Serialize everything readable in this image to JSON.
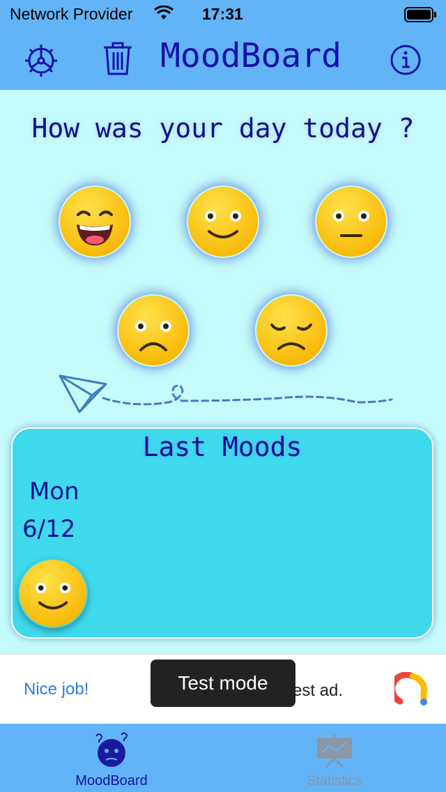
{
  "status_bar": {
    "carrier": "Network Provider",
    "time": "17:31"
  },
  "nav": {
    "title": "MoodBoard",
    "settings_icon": "gear-icon",
    "delete_icon": "trash-icon",
    "info_icon": "info-icon"
  },
  "question": "How was your day today ?",
  "moods": [
    {
      "name": "very-happy"
    },
    {
      "name": "happy"
    },
    {
      "name": "neutral"
    },
    {
      "name": "sad"
    },
    {
      "name": "very-sad"
    }
  ],
  "last_moods": {
    "title": "Last Moods",
    "entries": [
      {
        "day": "Mon",
        "date": "6/12",
        "mood": "happy"
      }
    ]
  },
  "ad": {
    "text": "Nice job!",
    "test_suffix": "est ad.",
    "toast": "Test mode"
  },
  "tabs": [
    {
      "label": "MoodBoard",
      "icon": "confused-face-icon",
      "active": true
    },
    {
      "label": "Statistics",
      "icon": "chart-board-icon",
      "active": false
    }
  ],
  "colors": {
    "header": "#63b4f7",
    "background": "#c5fbfb",
    "card": "#3ed9ec",
    "title_text": "#1212a8",
    "emoji": "#ffcc00"
  }
}
